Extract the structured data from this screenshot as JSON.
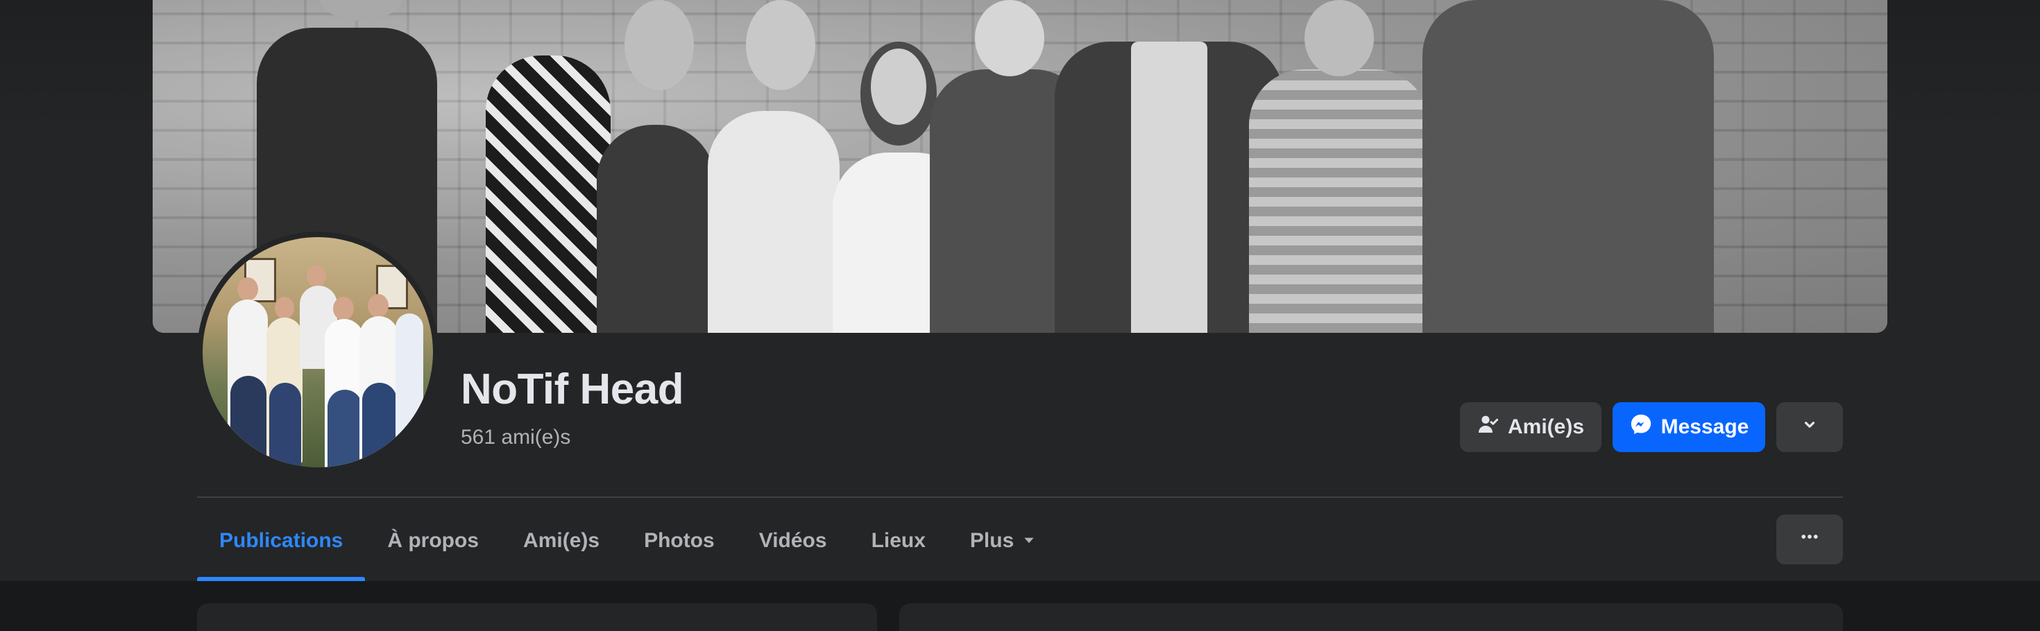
{
  "profile": {
    "name": "NoTif Head",
    "friend_count": "561 ami(e)s"
  },
  "actions": {
    "friends_label": "Ami(e)s",
    "message_label": "Message"
  },
  "tabs": [
    {
      "label": "Publications",
      "active": true
    },
    {
      "label": "À propos"
    },
    {
      "label": "Ami(e)s"
    },
    {
      "label": "Photos"
    },
    {
      "label": "Vidéos"
    },
    {
      "label": "Lieux"
    },
    {
      "label": "Plus"
    }
  ],
  "icons": {
    "friends": "person-check-icon",
    "message": "messenger-icon",
    "dropdown": "chevron-down-icon",
    "more": "more-dots-icon",
    "plus_caret": "caret-down-icon"
  },
  "colors": {
    "background": "#18191a",
    "surface": "#242526",
    "button_secondary": "#3a3b3c",
    "accent": "#0866ff",
    "active_tab": "#2d88ff",
    "text_primary": "#e4e6eb",
    "text_secondary": "#b0b3b8"
  }
}
